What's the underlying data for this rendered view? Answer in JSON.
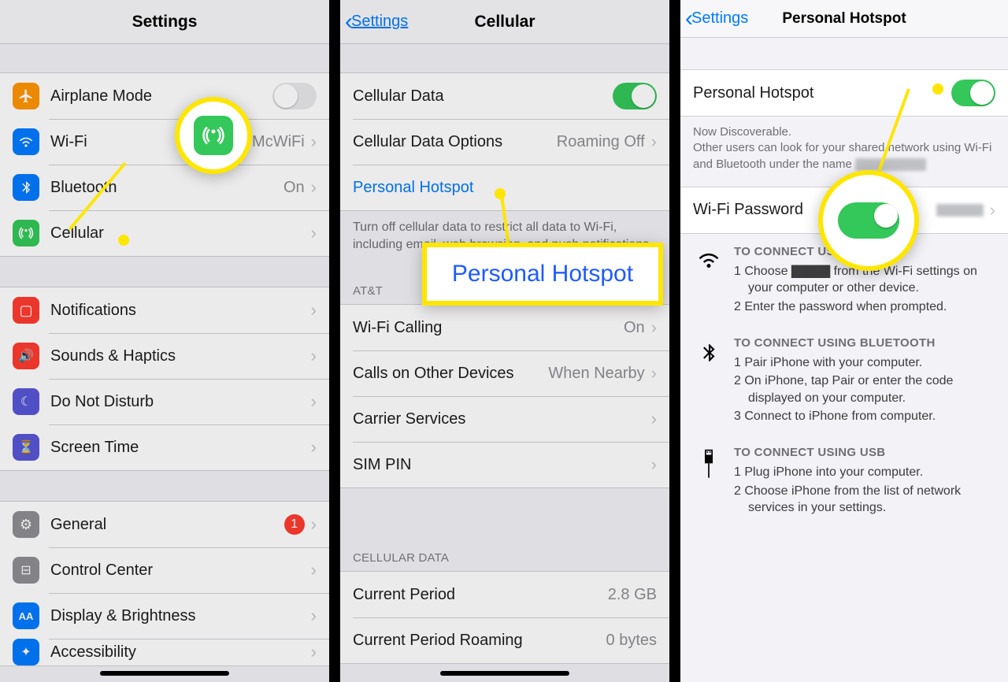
{
  "panel1": {
    "title": "Settings",
    "group1": [
      {
        "icon": "airplane",
        "label": "Airplane Mode",
        "toggle": false
      },
      {
        "icon": "wifi",
        "label": "Wi-Fi",
        "value": "McWiFi",
        "chevron": true
      },
      {
        "icon": "bluetooth",
        "label": "Bluetooth",
        "value": "On",
        "chevron": true
      },
      {
        "icon": "cellular",
        "label": "Cellular",
        "chevron": true
      }
    ],
    "group2": [
      {
        "icon": "notif",
        "label": "Notifications",
        "chevron": true
      },
      {
        "icon": "sound",
        "label": "Sounds & Haptics",
        "chevron": true
      },
      {
        "icon": "dnd",
        "label": "Do Not Disturb",
        "chevron": true
      },
      {
        "icon": "st",
        "label": "Screen Time",
        "chevron": true
      }
    ],
    "group3": [
      {
        "icon": "gen",
        "label": "General",
        "badge": "1",
        "chevron": true
      },
      {
        "icon": "cc",
        "label": "Control Center",
        "chevron": true
      },
      {
        "icon": "disp",
        "label": "Display & Brightness",
        "chevron": true
      },
      {
        "icon": "acc",
        "label": "Accessibility",
        "chevron": true
      }
    ]
  },
  "panel2": {
    "back": "Settings",
    "title": "Cellular",
    "group1": [
      {
        "label": "Cellular Data",
        "toggle": true
      },
      {
        "label": "Cellular Data Options",
        "value": "Roaming Off",
        "chevron": true
      },
      {
        "label": "Personal Hotspot",
        "link": true
      }
    ],
    "footer1": "Turn off cellular data to restrict all data to Wi-Fi, including email, web browsing, and push notifications.",
    "sect2_header": "AT&T",
    "group2": [
      {
        "label": "Wi-Fi Calling",
        "value": "On",
        "chevron": true
      },
      {
        "label": "Calls on Other Devices",
        "value": "When Nearby",
        "chevron": true
      },
      {
        "label": "Carrier Services",
        "chevron": true
      },
      {
        "label": "SIM PIN",
        "chevron": true
      }
    ],
    "sect3_header": "CELLULAR DATA",
    "group3": [
      {
        "label": "Current Period",
        "value": "2.8 GB"
      },
      {
        "label": "Current Period Roaming",
        "value": "0 bytes"
      }
    ],
    "popup": "Personal Hotspot"
  },
  "panel3": {
    "back": "Settings",
    "title": "Personal Hotspot",
    "row_hotspot": {
      "label": "Personal Hotspot",
      "toggle": true
    },
    "discover_line1": "Now Discoverable.",
    "discover_line2": "Other users can look for your shared network using Wi-Fi and Bluetooth under the name ",
    "row_password": {
      "label": "Wi-Fi Password"
    },
    "conn_wifi": {
      "header": "TO CONNECT USING WI-FI",
      "steps": [
        "Choose ▇▇▇▇ from the Wi-Fi settings on your computer or other device.",
        "Enter the password when prompted."
      ]
    },
    "conn_bt": {
      "header": "TO CONNECT USING BLUETOOTH",
      "steps": [
        "Pair iPhone with your computer.",
        "On iPhone, tap Pair or enter the code displayed on your computer.",
        "Connect to iPhone from computer."
      ]
    },
    "conn_usb": {
      "header": "TO CONNECT USING USB",
      "steps": [
        "Plug iPhone into your computer.",
        "Choose iPhone from the list of network services in your settings."
      ]
    }
  }
}
